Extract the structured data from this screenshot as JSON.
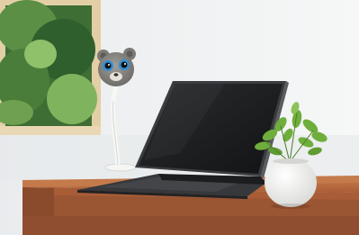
{
  "scene": {
    "description_items": [
      "window-with-greenery",
      "bear-head-gooseneck-webcam",
      "tablet-with-keyboard-case",
      "potted-plant",
      "wooden-desk"
    ]
  },
  "colors": {
    "wall": "#eef0f1",
    "wall_shadow": "#dfe3e6",
    "window_frame": "#e2cfa6",
    "foliage_dark": "#2f5f2c",
    "foliage_light": "#8fc06a",
    "desk_top": "#b4673f",
    "desk_front": "#9a5533",
    "tablet_body": "#2b2d30",
    "tablet_screen": "#1a1b1d",
    "keyboard": "#3a3c3f",
    "bear_head": "#8f8d88",
    "bear_eye_ring": "#2f8fd6",
    "pot": "#f3f3f1",
    "plant_leaf": "#6fae3c"
  }
}
